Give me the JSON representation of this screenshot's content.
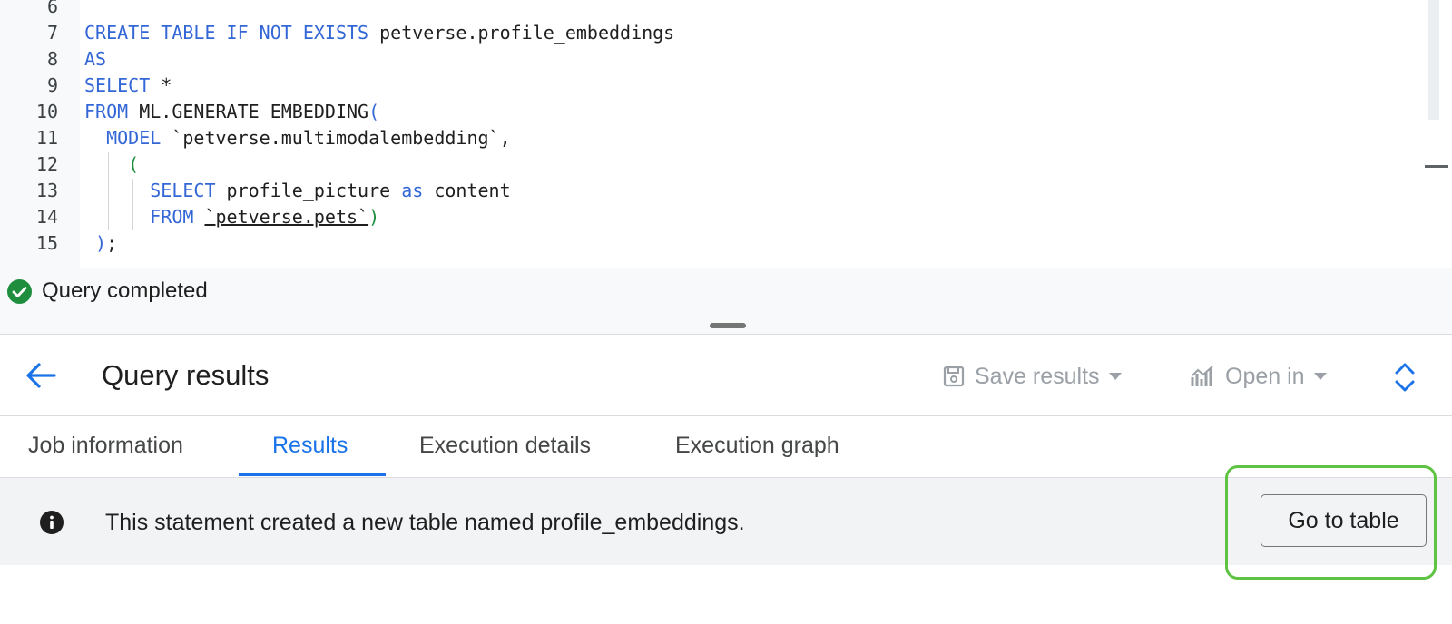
{
  "editor": {
    "lines": [
      {
        "num": "6",
        "tokens": []
      },
      {
        "num": "7",
        "tokens": [
          {
            "t": "CREATE TABLE IF NOT EXISTS",
            "c": "kw"
          },
          {
            "t": " petverse.profile_embeddings",
            "c": "plain"
          }
        ]
      },
      {
        "num": "8",
        "tokens": [
          {
            "t": "AS",
            "c": "kw"
          }
        ]
      },
      {
        "num": "9",
        "tokens": [
          {
            "t": "SELECT",
            "c": "kw"
          },
          {
            "t": " *",
            "c": "plain"
          }
        ]
      },
      {
        "num": "10",
        "tokens": [
          {
            "t": "FROM",
            "c": "kw"
          },
          {
            "t": " ML.GENERATE_EMBEDDING",
            "c": "plain"
          },
          {
            "t": "(",
            "c": "paren"
          }
        ]
      },
      {
        "num": "11",
        "tokens": [
          {
            "t": "  MODEL",
            "c": "kw"
          },
          {
            "t": " `petverse.multimodalembedding`,",
            "c": "plain"
          }
        ]
      },
      {
        "num": "12",
        "tokens": [
          {
            "t": "    (",
            "c": "paren2"
          }
        ]
      },
      {
        "num": "13",
        "tokens": [
          {
            "t": "      SELECT",
            "c": "kw"
          },
          {
            "t": " profile_picture ",
            "c": "plain"
          },
          {
            "t": "as",
            "c": "kw"
          },
          {
            "t": " content",
            "c": "plain"
          }
        ]
      },
      {
        "num": "14",
        "tokens": [
          {
            "t": "      FROM",
            "c": "kw"
          },
          {
            "t": " ",
            "c": "plain"
          },
          {
            "t": "`petverse.pets`",
            "c": "plain underline"
          },
          {
            "t": ")",
            "c": "paren2"
          }
        ]
      },
      {
        "num": "15",
        "tokens": [
          {
            "t": " )",
            "c": "paren"
          },
          {
            "t": ";",
            "c": "plain"
          }
        ]
      }
    ]
  },
  "status": {
    "text": "Query completed"
  },
  "results": {
    "title": "Query results",
    "save_label": "Save results",
    "open_label": "Open in",
    "tabs": [
      {
        "label": "Job information"
      },
      {
        "label": "Results"
      },
      {
        "label": "Execution details"
      },
      {
        "label": "Execution graph"
      }
    ],
    "active_tab": "Results",
    "banner_text": "This statement created a new table named profile_embeddings.",
    "go_to_table_label": "Go to table"
  },
  "colors": {
    "keyword": "#3367d6",
    "success": "#1e8e3e",
    "accent": "#1a73e8",
    "highlight": "#5ec342"
  }
}
